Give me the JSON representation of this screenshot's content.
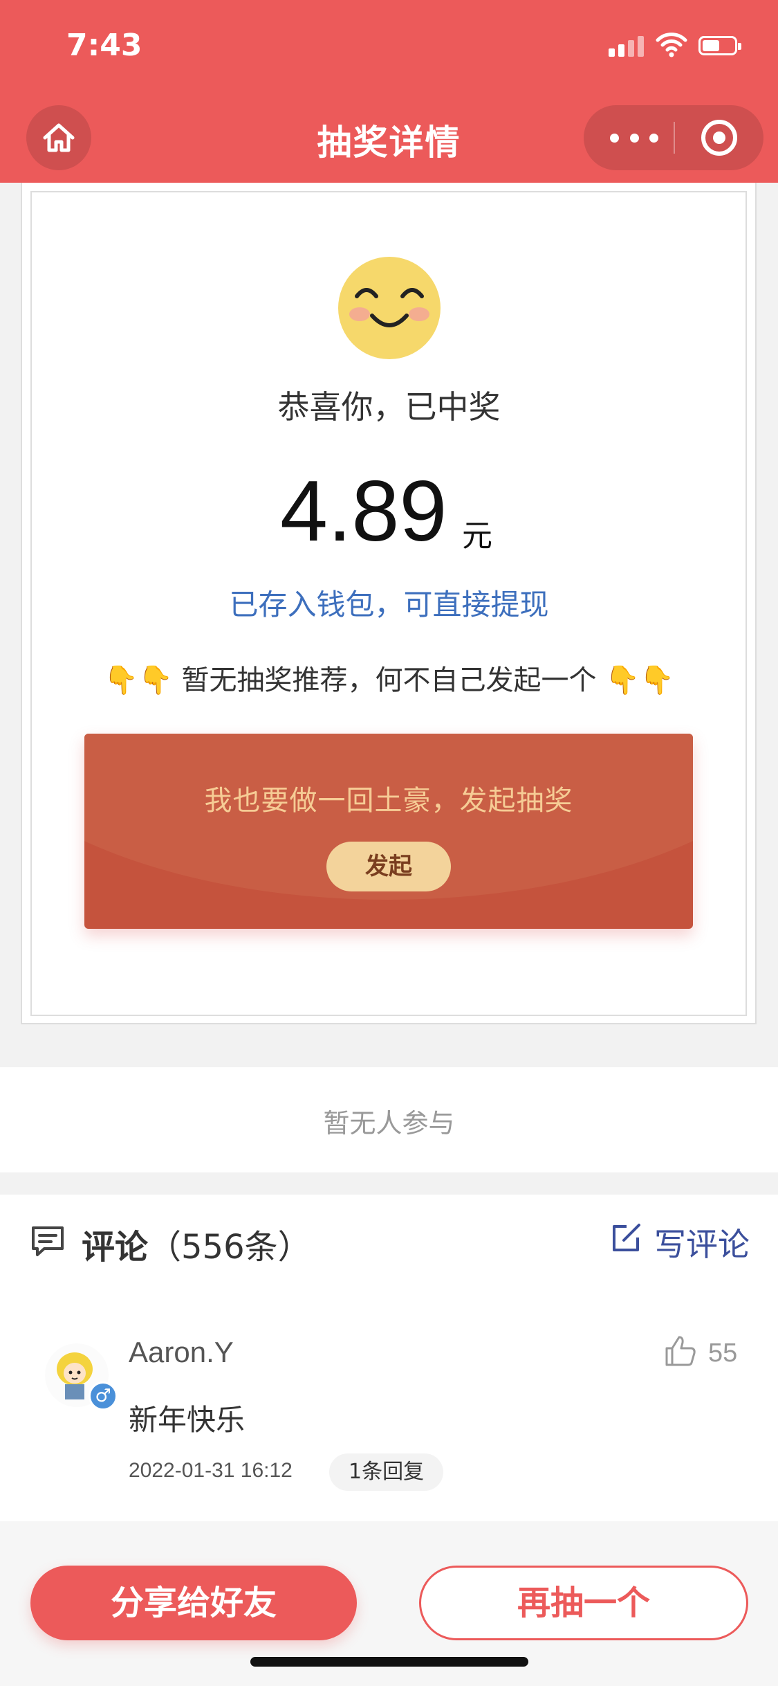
{
  "status_bar": {
    "time": "7:43"
  },
  "nav": {
    "title": "抽奖详情"
  },
  "prize": {
    "congrats": "恭喜你，已中奖",
    "amount": "4.89",
    "unit": "元",
    "wallet_note": "已存入钱包，可直接提现",
    "recommend": "👇👇 暂无抽奖推荐，何不自己发起一个 👇👇",
    "launch_text": "我也要做一回土豪，发起抽奖",
    "launch_button": "发起"
  },
  "participants": {
    "empty_text": "暂无人参与"
  },
  "comments": {
    "title": "评论",
    "count": "（556条）",
    "write_label": "写评论",
    "items": [
      {
        "name": "Aaron.Y",
        "likes": "55",
        "text": "新年快乐",
        "date": "2022-01-31 16:12",
        "replies": "1条回复"
      }
    ]
  },
  "bottom": {
    "share_label": "分享给好友",
    "again_label": "再抽一个"
  },
  "colors": {
    "brand_red": "#ec5a5a",
    "link_blue": "#3d6fbd",
    "envelope": "#c5533d",
    "gold": "#f3d39b"
  }
}
